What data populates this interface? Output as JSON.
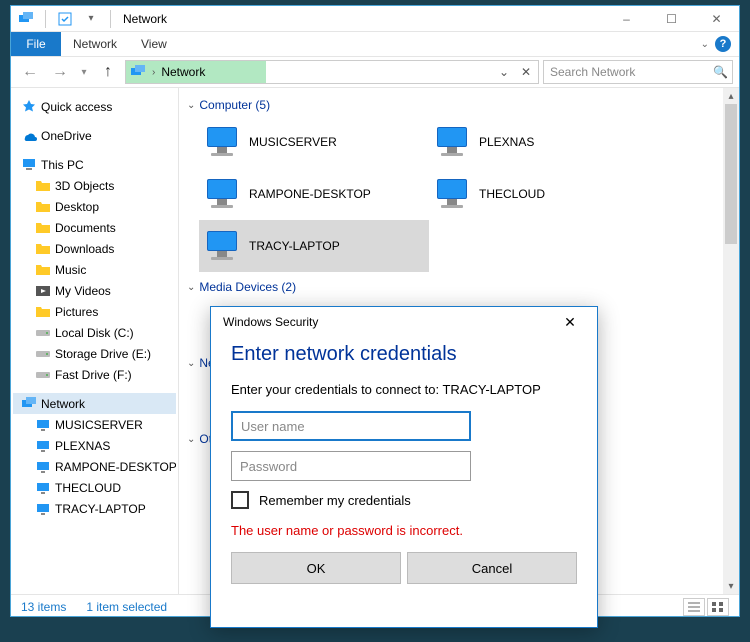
{
  "window": {
    "title": "Network",
    "minimize": "–",
    "maximize": "☐",
    "close": "✕"
  },
  "menubar": {
    "file": "File",
    "items": [
      "Network",
      "View"
    ]
  },
  "nav": {
    "address": "Network",
    "search_placeholder": "Search Network"
  },
  "tree": {
    "quick_access": "Quick access",
    "onedrive": "OneDrive",
    "this_pc": "This PC",
    "pc_children": [
      "3D Objects",
      "Desktop",
      "Documents",
      "Downloads",
      "Music",
      "My Videos",
      "Pictures",
      "Local Disk (C:)",
      "Storage Drive (E:)",
      "Fast Drive (F:)"
    ],
    "network": "Network",
    "net_children": [
      "MUSICSERVER",
      "PLEXNAS",
      "RAMPONE-DESKTOP",
      "THECLOUD",
      "TRACY-LAPTOP"
    ]
  },
  "content": {
    "group_computer": "Computer (5)",
    "computers": [
      "MUSICSERVER",
      "PLEXNAS",
      "RAMPONE-DESKTOP",
      "THECLOUD",
      "TRACY-LAPTOP"
    ],
    "group_media": "Media Devices (2)",
    "group_net_infra_short": "Netw",
    "group_other_short": "Othe"
  },
  "status": {
    "items": "13 items",
    "selected": "1 item selected"
  },
  "dialog": {
    "title": "Windows Security",
    "heading": "Enter network credentials",
    "subtitle": "Enter your credentials to connect to: TRACY-LAPTOP",
    "user_placeholder": "User name",
    "pass_placeholder": "Password",
    "remember": "Remember my credentials",
    "error": "The user name or password is incorrect.",
    "ok": "OK",
    "cancel": "Cancel"
  }
}
